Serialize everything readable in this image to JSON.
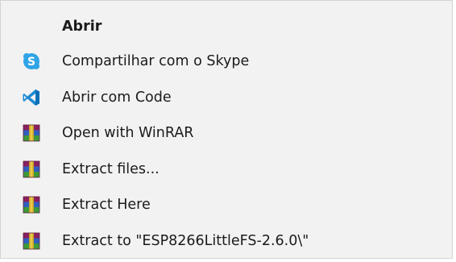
{
  "context_menu": {
    "items": [
      {
        "label": "Abrir",
        "icon": "none",
        "bold": true
      },
      {
        "label": "Compartilhar com o Skype",
        "icon": "skype-icon"
      },
      {
        "label": "Abrir com Code",
        "icon": "vscode-icon"
      },
      {
        "label": "Open with WinRAR",
        "icon": "winrar-icon"
      },
      {
        "label": "Extract files...",
        "icon": "winrar-icon"
      },
      {
        "label": "Extract Here",
        "icon": "winrar-icon"
      },
      {
        "label": "Extract to \"ESP8266LittleFS-2.6.0\\\"",
        "icon": "winrar-icon"
      }
    ]
  },
  "colors": {
    "background": "#f2f2f2",
    "text": "#1b1b1b",
    "skype": "#2fa4e7",
    "vscode": "#1f8ad2"
  }
}
